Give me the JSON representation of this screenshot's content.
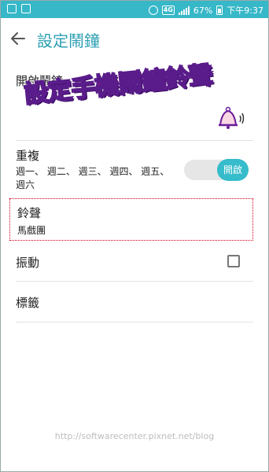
{
  "status_bar": {
    "battery": "67%",
    "network": "4G",
    "time": "下午9:37"
  },
  "header": {
    "title": "設定鬧鐘"
  },
  "settings": {
    "name_title": "開啟鬧鐘",
    "overlay_banner": "設定手機鬧鐘鈴聲",
    "repeat": {
      "title": "重複",
      "subtitle": "週一、 週二、 週三、 週四、 週五、 週六",
      "toggle_label": "開啟"
    },
    "ringtone": {
      "title": "鈴聲",
      "value": "馬戲團"
    },
    "vibrate": {
      "title": "振動"
    },
    "label": {
      "title": "標籤"
    }
  },
  "watermark": "http://softwarecenter.pixnet.net/blog",
  "colors": {
    "status_bar": "#37b8c8",
    "accent": "#2c9fb3",
    "toggle_on": "#36bccb",
    "highlight_border": "#d0021b",
    "banner_fill": "#e6007e"
  },
  "icons": [
    "back-arrow-icon",
    "bell-icon",
    "alarm-clock-icon",
    "image-icon",
    "wifi-icon",
    "battery-icon",
    "checkbox-icon"
  ]
}
